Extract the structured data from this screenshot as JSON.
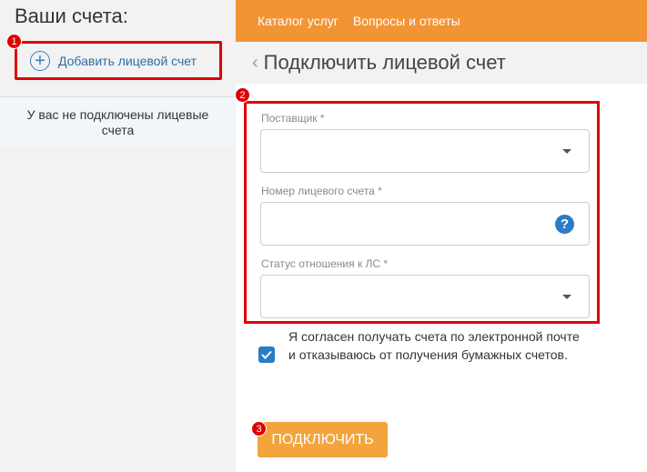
{
  "sidebar": {
    "title": "Ваши счета:",
    "add_account_label": "Добавить лицевой счет",
    "empty_message": "У вас не подключены лицевые счета"
  },
  "nav": {
    "items": [
      {
        "label": "Каталог услуг"
      },
      {
        "label": "Вопросы и ответы"
      }
    ]
  },
  "page": {
    "title": "Подключить лицевой счет"
  },
  "form": {
    "supplier_label": "Поставщик *",
    "supplier_value": "",
    "account_number_label": "Номер лицевого счета *",
    "account_number_value": "",
    "relation_status_label": "Статус отношения к ЛС *",
    "relation_status_value": "",
    "agree_text": "Я согласен получать счета по электронной почте и отказываюсь от получения бумажных счетов.",
    "agree_checked": true,
    "connect_label": "ПОДКЛЮЧИТЬ"
  },
  "annotations": {
    "badge1": "1",
    "badge2": "2",
    "badge3": "3"
  },
  "colors": {
    "accent_orange": "#f39434",
    "button_orange": "#f3a43c",
    "highlight_red": "#e00000",
    "link_blue": "#2e6ca8",
    "checkbox_blue": "#2b7bc7"
  }
}
